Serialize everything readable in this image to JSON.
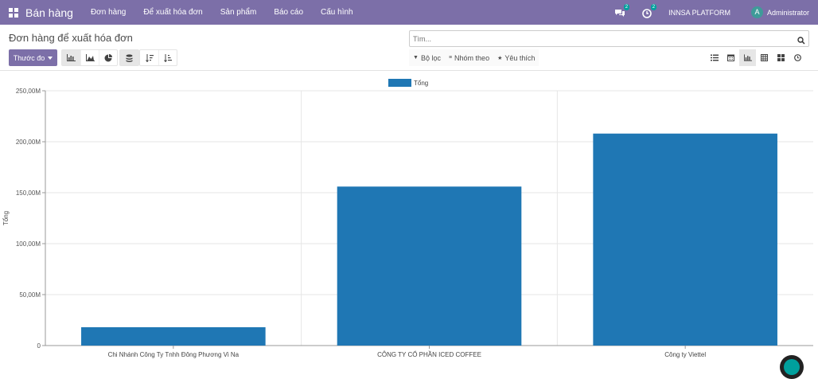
{
  "app": {
    "name": "Bán hàng",
    "menu": [
      "Đơn hàng",
      "Để xuất hóa đơn",
      "Sản phẩm",
      "Báo cáo",
      "Cấu hình"
    ],
    "messages_badge": "2",
    "activities_badge": "2",
    "company": "INNSA PLATFORM",
    "avatar_letter": "A",
    "user": "Administrator"
  },
  "control_panel": {
    "title": "Đơn hàng để xuất hóa đơn",
    "search_placeholder": "Tìm...",
    "measure_button": "Thước đo",
    "filter_label": "Bộ lọc",
    "groupby_label": "Nhóm theo",
    "favorites_label": "Yêu thích"
  },
  "chart_data": {
    "type": "bar",
    "categories": [
      "Chi Nhánh Công Ty Tnhh Đông Phương Vi Na",
      "CÔNG TY CỔ PHẦN ICED COFFEE",
      "Công ty Viettel"
    ],
    "series": [
      {
        "name": "Tổng",
        "values": [
          18000000,
          156000000,
          208000000
        ],
        "color": "#1f77b4"
      }
    ],
    "ylabel": "Tổng",
    "ylim": [
      0,
      250000000
    ],
    "yticks": [
      0,
      50000000,
      100000000,
      150000000,
      200000000,
      250000000
    ],
    "ytick_labels": [
      "0",
      "50,00M",
      "100,00M",
      "150,00M",
      "200,00M",
      "250,00M"
    ],
    "grid": true,
    "legend": "top-center"
  }
}
